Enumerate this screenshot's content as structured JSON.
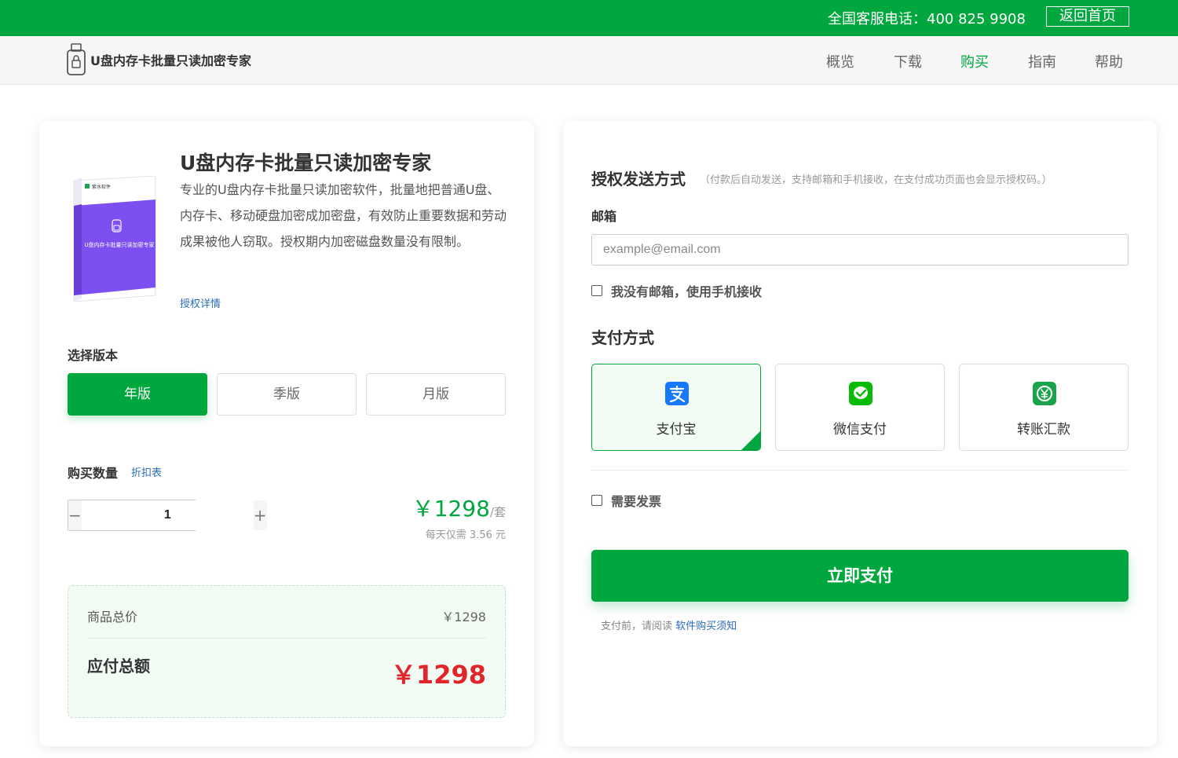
{
  "topbar": {
    "phone": "全国客服电话：400 825 9908",
    "home_button": "返回首页",
    "brand_color": "#00a63e"
  },
  "nav": {
    "logo_text": "U盘内存卡批量只读加密专家",
    "items": [
      {
        "label": "概览",
        "active": false
      },
      {
        "label": "下载",
        "active": false
      },
      {
        "label": "购买",
        "active": true
      },
      {
        "label": "指南",
        "active": false
      },
      {
        "label": "帮助",
        "active": false
      }
    ]
  },
  "product": {
    "box_brand": "紫水软件",
    "box_title": "U盘内存卡批量只读加密专家",
    "title": "U盘内存卡批量只读加密专家",
    "description": "专业的U盘内存卡批量只读加密软件，批量地把普通U盘、内存卡、移动硬盘加密成加密盘，有效防止重要数据和劳动成果被他人窃取。授权期内加密磁盘数量没有限制。",
    "license_link": "授权详情"
  },
  "version": {
    "label": "选择版本",
    "options": [
      "年版",
      "季版",
      "月版"
    ],
    "selected": "年版"
  },
  "quantity": {
    "label": "购买数量",
    "discount_link": "折扣表",
    "value": "1",
    "minus": "−",
    "plus": "+"
  },
  "price": {
    "amount": "￥1298",
    "unit": "/套",
    "per_day": "每天仅需 3.56 元"
  },
  "summary": {
    "subtotal_label": "商品总价",
    "subtotal_value": "￥1298",
    "total_label": "应付总额",
    "total_value": "￥1298",
    "total_color": "#e0252b"
  },
  "delivery": {
    "title": "授权发送方式",
    "note": "（付款后自动发送，支持邮箱和手机接收，在支付成功页面也会显示授权码。）",
    "email_label": "邮箱",
    "email_placeholder": "example@email.com",
    "email_value": "",
    "no_email_label": "我没有邮箱，使用手机接收",
    "no_email_checked": false
  },
  "payment": {
    "title": "支付方式",
    "options": [
      {
        "label": "支付宝",
        "icon": "alipay-icon",
        "selected": true
      },
      {
        "label": "微信支付",
        "icon": "wechat-pay-icon",
        "selected": false
      },
      {
        "label": "转账汇款",
        "icon": "bank-transfer-icon",
        "selected": false
      }
    ],
    "invoice_label": "需要发票",
    "invoice_checked": false,
    "pay_button": "立即支付",
    "terms_prefix": "支付前，请阅读",
    "terms_link": "软件购买须知"
  }
}
